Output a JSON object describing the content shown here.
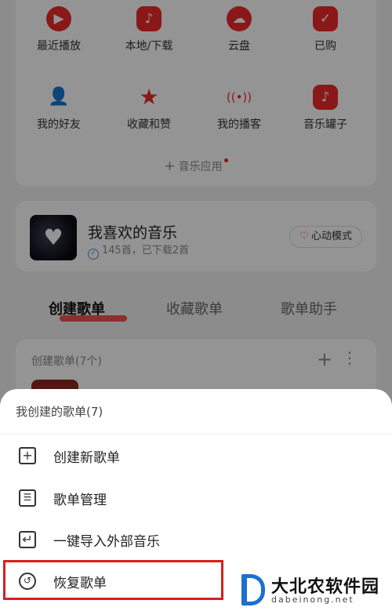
{
  "grid": {
    "row1": [
      {
        "label": "最近播放",
        "icon": "play-icon",
        "glyph": "▶"
      },
      {
        "label": "本地/下载",
        "icon": "music-note-icon",
        "glyph": "♪"
      },
      {
        "label": "云盘",
        "icon": "cloud-upload-icon",
        "glyph": "☁"
      },
      {
        "label": "已购",
        "icon": "purchased-icon",
        "glyph": "✓"
      }
    ],
    "row2": [
      {
        "label": "我的好友",
        "icon": "friends-icon",
        "glyph": "👤"
      },
      {
        "label": "收藏和赞",
        "icon": "star-icon",
        "glyph": "★"
      },
      {
        "label": "我的播客",
        "icon": "podcast-icon",
        "glyph": "((•))"
      },
      {
        "label": "音乐罐子",
        "icon": "music-jar-icon",
        "glyph": "♪"
      }
    ],
    "add_app": "音乐应用"
  },
  "favorite": {
    "title": "我喜欢的音乐",
    "subtitle": "145首，已下载2首",
    "mode_button": "心动模式"
  },
  "tabs": [
    "创建歌单",
    "收藏歌单",
    "歌单助手"
  ],
  "playlist_section": {
    "header": "创建歌单(7个)"
  },
  "sheet": {
    "title": "我创建的歌单(7)",
    "items": [
      {
        "label": "创建新歌单",
        "icon": "plus-square-icon",
        "glyph": "+"
      },
      {
        "label": "歌单管理",
        "icon": "list-manage-icon",
        "glyph": "☰"
      },
      {
        "label": "一键导入外部音乐",
        "icon": "import-icon",
        "glyph": "↵"
      },
      {
        "label": "恢复歌单",
        "icon": "history-clock-icon",
        "glyph": "↺"
      }
    ]
  },
  "watermark": {
    "title": "大北农软件园",
    "subtitle": "dabeinong.net"
  },
  "colors": {
    "accent": "#ee2a2a",
    "highlight_border": "#d81e1e",
    "watermark_blue": "#1d6fd1"
  }
}
